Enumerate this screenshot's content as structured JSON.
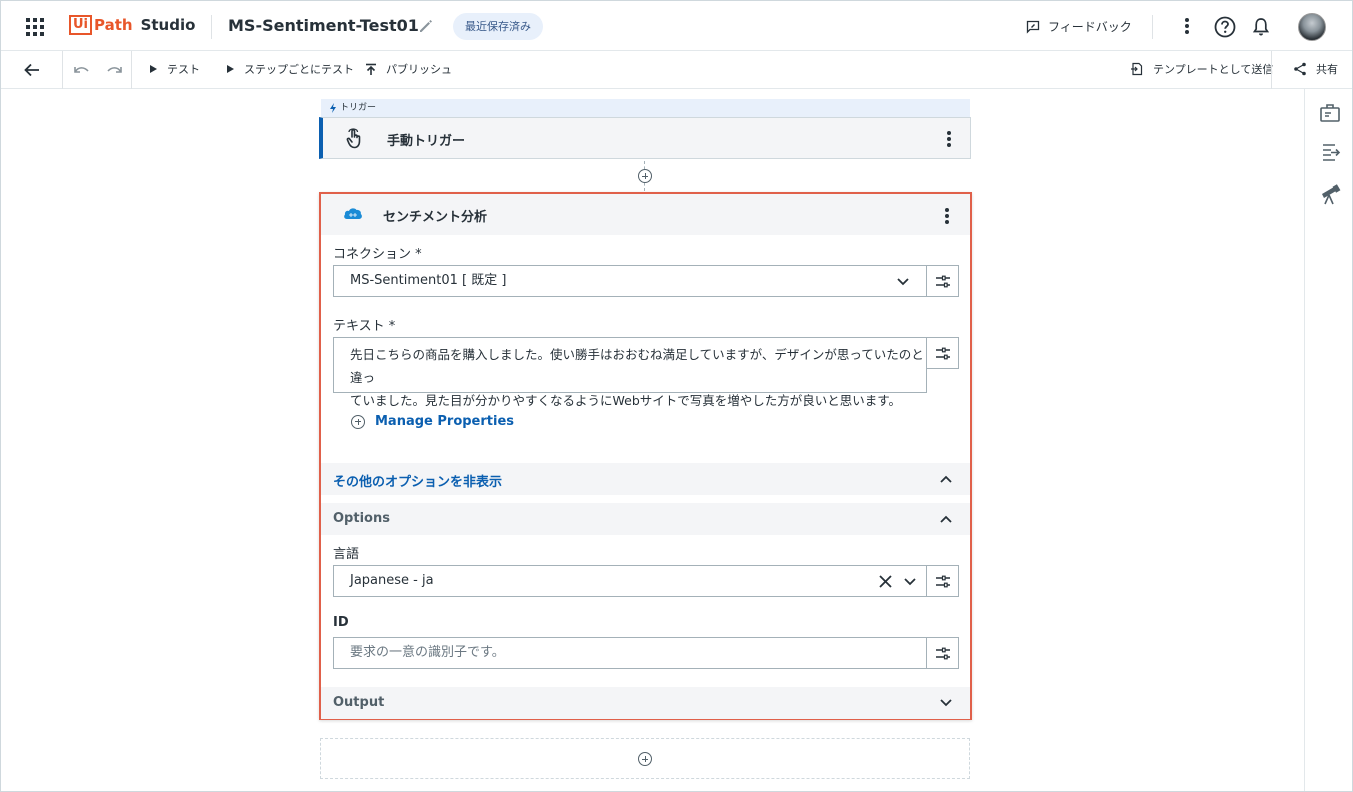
{
  "app": {
    "logo_ui": "Ui",
    "logo_path": "Path",
    "logo_studio": "Studio",
    "project_title": "MS-Sentiment-Test01",
    "save_status": "最近保存済み",
    "feedback_label": "フィードバック"
  },
  "toolbar": {
    "test_label": "テスト",
    "step_test_label": "ステップごとにテスト",
    "publish_label": "パブリッシュ",
    "send_template_label": "テンプレートとして送信",
    "share_label": "共有"
  },
  "trigger": {
    "tag": "トリガー",
    "title": "手動トリガー"
  },
  "activity": {
    "title": "センチメント分析",
    "connection_label": "コネクション *",
    "connection_value": "MS-Sentiment01 [ 既定 ]",
    "text_label": "テキスト *",
    "text_value_line1": "先日こちらの商品を購入しました。使い勝手はおおむね満足していますが、デザインが思っていたのと違っ",
    "text_value_line2": "ていました。見た目が分かりやすくなるようにWebサイトで写真を増やした方が良いと思います。",
    "manage_properties": "Manage Properties",
    "hide_options": "その他のオプションを非表示",
    "options_section": "Options",
    "language_label": "言語",
    "language_value": "Japanese - ja",
    "id_label": "ID",
    "id_placeholder": "要求の一意の識別子です。",
    "output_section": "Output"
  },
  "colors": {
    "brand_orange": "#e8562a",
    "accent_blue": "#0b5fb0",
    "selected_border": "#e0604a"
  }
}
